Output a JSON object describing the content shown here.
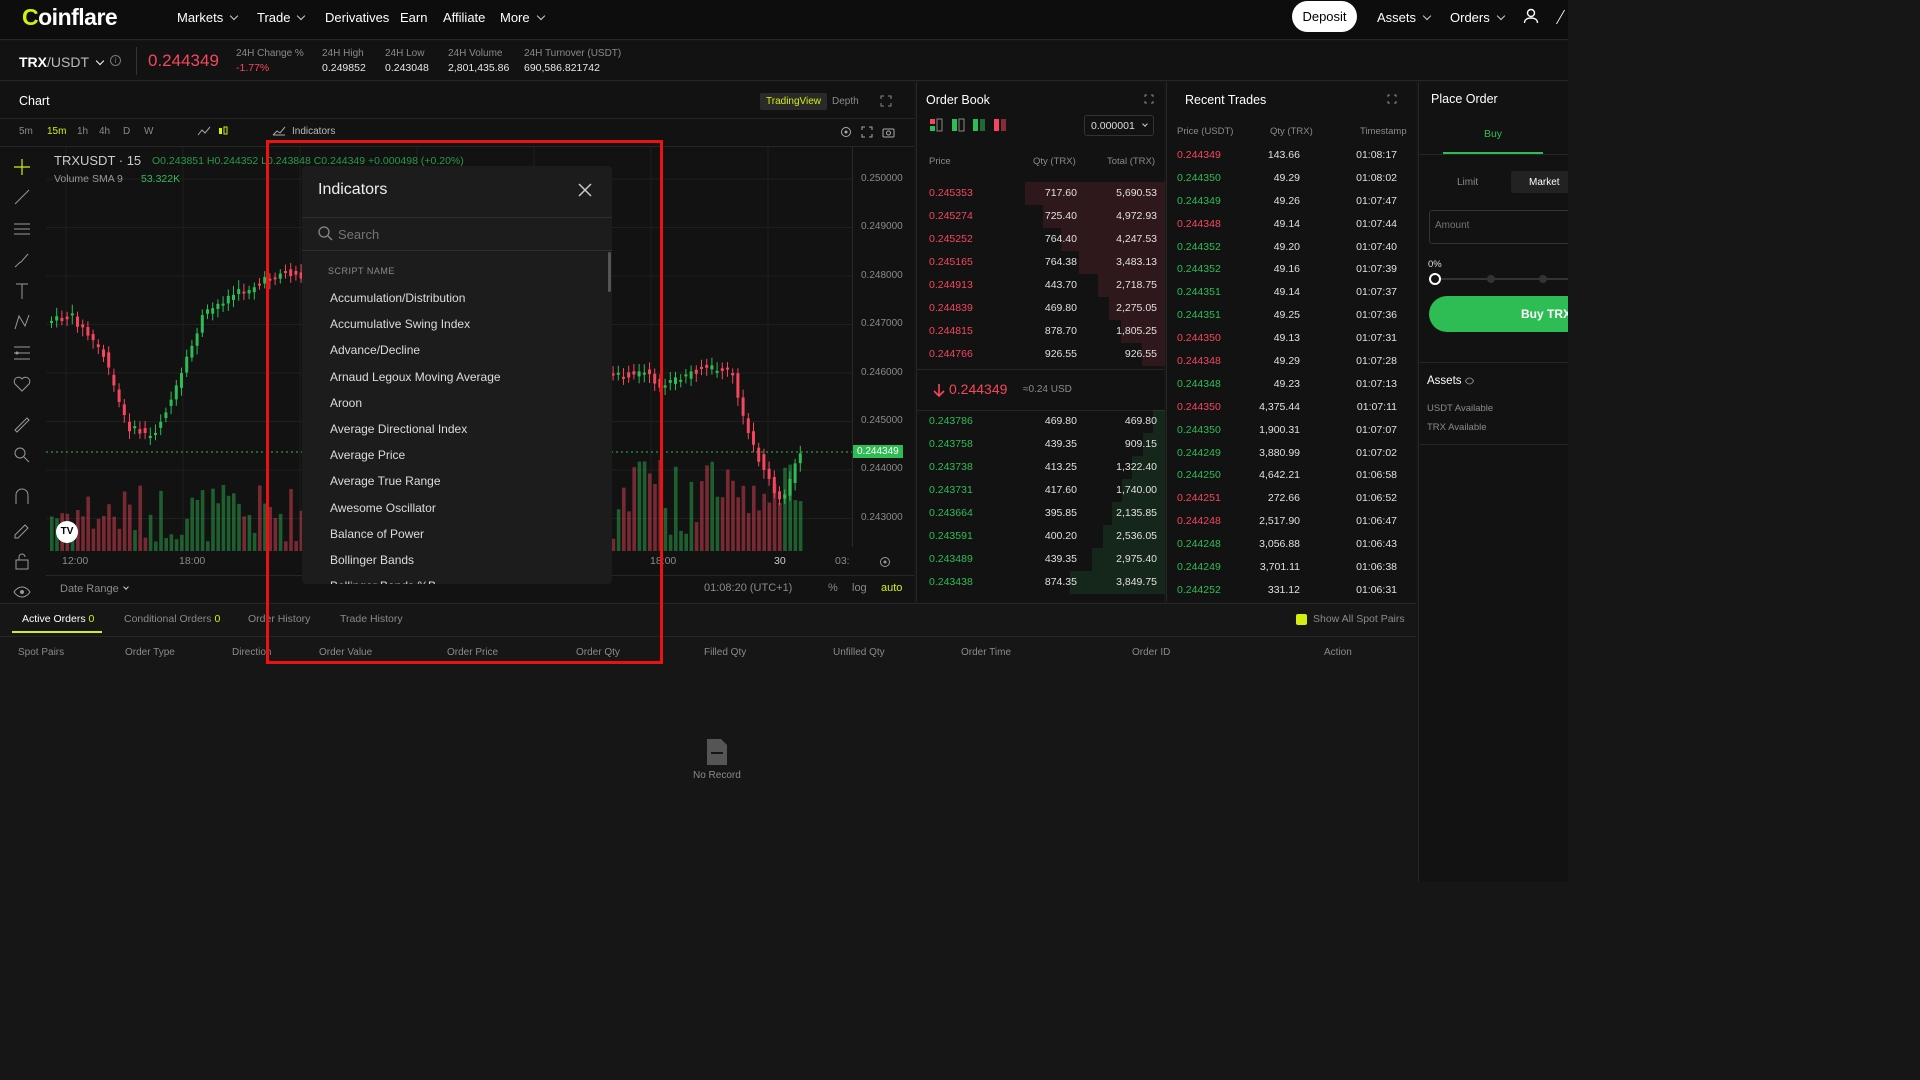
{
  "nav": {
    "logo_c": "C",
    "logo_rest": "oinflare",
    "items": [
      "Markets",
      "Trade",
      "Derivatives",
      "Earn",
      "Affiliate",
      "More"
    ],
    "deposit_label": "Deposit",
    "assets_label": "Assets",
    "orders_label": "Orders"
  },
  "ticker": {
    "pair_base": "TRX",
    "pair_quote": "/USDT",
    "price": "0.244349",
    "stats": [
      {
        "label": "24H Change %",
        "value": "-1.77%"
      },
      {
        "label": "24H High",
        "value": "0.249852"
      },
      {
        "label": "24H Low",
        "value": "0.243048"
      },
      {
        "label": "24H Volume",
        "value": "2,801,435.86"
      },
      {
        "label": "24H Turnover (USDT)",
        "value": "690,586.821742"
      }
    ]
  },
  "chart": {
    "title": "Chart",
    "view_tabs": [
      "TradingView",
      "Depth"
    ],
    "intervals": [
      "5m",
      "15m",
      "1h",
      "4h",
      "D",
      "W"
    ],
    "indicators_label": "Indicators",
    "symbol": "TRXUSDT · 15",
    "ohlc": "O0.243851 H0.244352 L0.243848 C0.244349 +0.000498 (+0.20%)",
    "volume": "Volume SMA 9",
    "volume_val": "53.322K",
    "price_axis": [
      "0.250000",
      "0.249000",
      "0.248000",
      "0.247000",
      "0.246000",
      "0.245000",
      "0.244000",
      "0.243000"
    ],
    "last_price_tag": "0.244349",
    "time_axis": [
      "12:00",
      "18:00",
      "18:00",
      "30",
      "03:"
    ],
    "date_range": "Date Range",
    "clock": "01:08:20 (UTC+1)",
    "scale_opts": [
      "%",
      "log",
      "auto"
    ]
  },
  "indicators_modal": {
    "title": "Indicators",
    "search_placeholder": "Search",
    "section": "SCRIPT NAME",
    "items": [
      "Accumulation/Distribution",
      "Accumulative Swing Index",
      "Advance/Decline",
      "Arnaud Legoux Moving Average",
      "Aroon",
      "Average Directional Index",
      "Average Price",
      "Average True Range",
      "Awesome Oscillator",
      "Balance of Power",
      "Bollinger Bands",
      "Bollinger Bands %B"
    ]
  },
  "orderbook": {
    "title": "Order Book",
    "precision": "0.000001",
    "headers": [
      "Price",
      "Qty (TRX)",
      "Total (TRX)"
    ],
    "asks": [
      [
        "0.245353",
        "717.60",
        "5,690.53"
      ],
      [
        "0.245274",
        "725.40",
        "4,972.93"
      ],
      [
        "0.245252",
        "764.40",
        "4,247.53"
      ],
      [
        "0.245165",
        "764.38",
        "3,483.13"
      ],
      [
        "0.244913",
        "443.70",
        "2,718.75"
      ],
      [
        "0.244839",
        "469.80",
        "2,275.05"
      ],
      [
        "0.244815",
        "878.70",
        "1,805.25"
      ],
      [
        "0.244766",
        "926.55",
        "926.55"
      ]
    ],
    "mid_price": "0.244349",
    "mid_usd": "≈0.24 USD",
    "bids": [
      [
        "0.243786",
        "469.80",
        "469.80"
      ],
      [
        "0.243758",
        "439.35",
        "909.15"
      ],
      [
        "0.243738",
        "413.25",
        "1,322.40"
      ],
      [
        "0.243731",
        "417.60",
        "1,740.00"
      ],
      [
        "0.243664",
        "395.85",
        "2,135.85"
      ],
      [
        "0.243591",
        "400.20",
        "2,536.05"
      ],
      [
        "0.243489",
        "439.35",
        "2,975.40"
      ],
      [
        "0.243438",
        "874.35",
        "3,849.75"
      ]
    ]
  },
  "trades": {
    "title": "Recent Trades",
    "headers": [
      "Price (USDT)",
      "Qty (TRX)",
      "Timestamp"
    ],
    "rows": [
      [
        "0.244349",
        "143.66",
        "01:08:17",
        "r"
      ],
      [
        "0.244350",
        "49.29",
        "01:08:02",
        "g"
      ],
      [
        "0.244349",
        "49.26",
        "01:07:47",
        "g"
      ],
      [
        "0.244348",
        "49.14",
        "01:07:44",
        "r"
      ],
      [
        "0.244352",
        "49.20",
        "01:07:40",
        "g"
      ],
      [
        "0.244352",
        "49.16",
        "01:07:39",
        "g"
      ],
      [
        "0.244351",
        "49.14",
        "01:07:37",
        "g"
      ],
      [
        "0.244351",
        "49.25",
        "01:07:36",
        "g"
      ],
      [
        "0.244350",
        "49.13",
        "01:07:31",
        "r"
      ],
      [
        "0.244348",
        "49.29",
        "01:07:28",
        "r"
      ],
      [
        "0.244348",
        "49.23",
        "01:07:13",
        "g"
      ],
      [
        "0.244350",
        "4,375.44",
        "01:07:11",
        "r"
      ],
      [
        "0.244350",
        "1,900.31",
        "01:07:07",
        "g"
      ],
      [
        "0.244249",
        "3,880.99",
        "01:07:02",
        "g"
      ],
      [
        "0.244250",
        "4,642.21",
        "01:06:58",
        "g"
      ],
      [
        "0.244251",
        "272.66",
        "01:06:52",
        "r"
      ],
      [
        "0.244248",
        "2,517.90",
        "01:06:47",
        "r"
      ],
      [
        "0.244248",
        "3,056.88",
        "01:06:43",
        "g"
      ],
      [
        "0.244249",
        "3,701.11",
        "01:06:38",
        "g"
      ],
      [
        "0.244252",
        "331.12",
        "01:06:31",
        "g"
      ]
    ]
  },
  "order": {
    "title": "Place Order",
    "buy_tab": "Buy",
    "types": [
      "Limit",
      "Market"
    ],
    "amount_placeholder": "Amount",
    "pct": "0%",
    "buy_button": "Buy TRX",
    "assets_title": "Assets",
    "usdt_avail": "USDT Available",
    "trx_avail": "TRX Available"
  },
  "bottom": {
    "tabs": [
      {
        "label": "Active Orders",
        "count": "0"
      },
      {
        "label": "Conditional Orders",
        "count": "0"
      },
      {
        "label": "Order History",
        "count": ""
      },
      {
        "label": "Trade History",
        "count": ""
      }
    ],
    "show_all": "Show All Spot Pairs",
    "columns": [
      "Spot Pairs",
      "Order Type",
      "Direction",
      "Order Value",
      "Order Price",
      "Order Qty",
      "Filled Qty",
      "Unfilled Qty",
      "Order Time",
      "Order ID",
      "Action"
    ],
    "empty": "No Record"
  },
  "colors": {
    "accent": "#d4ef0e",
    "red": "#f6465d",
    "green": "#2ebd55",
    "highlight": "#e11111"
  }
}
